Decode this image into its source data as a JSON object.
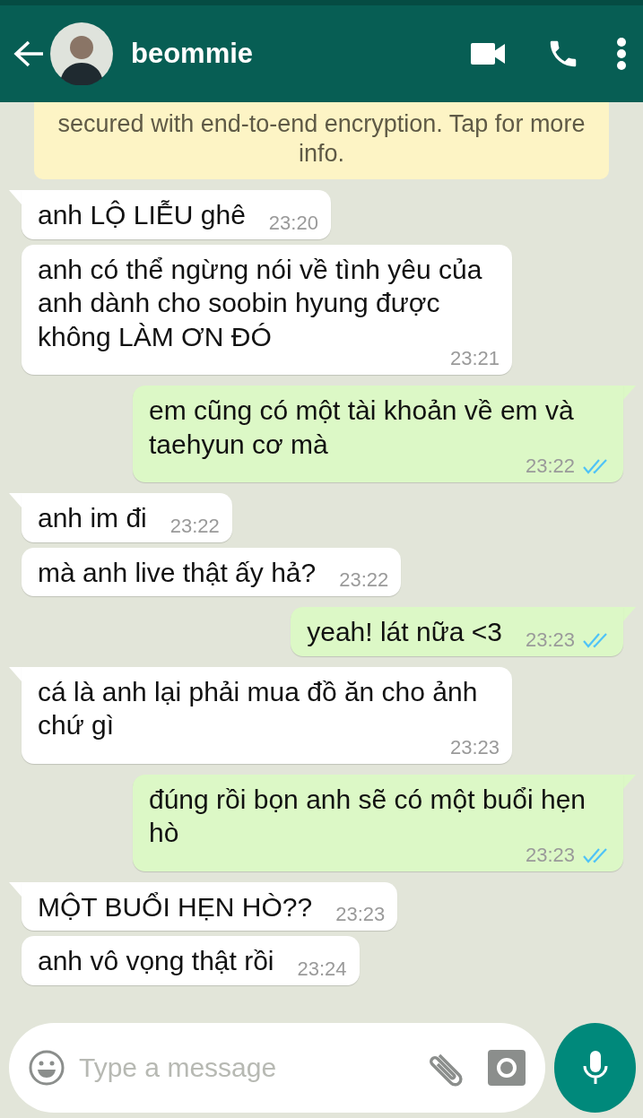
{
  "header": {
    "contact_name": "beommie"
  },
  "encryption_notice": "secured with end-to-end encryption. Tap for more info.",
  "messages": [
    {
      "kind": "in",
      "text": "anh LỘ LIỄU ghê",
      "time": "23:20"
    },
    {
      "kind": "in",
      "text": "anh có thể ngừng nói về tình yêu của anh dành cho soobin hyung được không LÀM ƠN ĐÓ",
      "time": "23:21"
    },
    {
      "kind": "out",
      "text": "em cũng có một tài khoản về em và taehyun cơ mà",
      "time": "23:22",
      "read": true
    },
    {
      "kind": "in",
      "text": "anh im đi",
      "time": "23:22"
    },
    {
      "kind": "in",
      "text": "mà anh live thật ấy hả?",
      "time": "23:22"
    },
    {
      "kind": "out",
      "text": "yeah! lát nữa <3",
      "time": "23:23",
      "read": true
    },
    {
      "kind": "in",
      "text": "cá là anh lại phải mua đồ ăn cho ảnh chứ gì",
      "time": "23:23"
    },
    {
      "kind": "out",
      "text": "đúng rồi bọn anh sẽ có một buổi hẹn hò",
      "time": "23:23",
      "read": true
    },
    {
      "kind": "in",
      "text": "MỘT BUỔI HẸN HÒ??",
      "time": "23:23"
    },
    {
      "kind": "in",
      "text": "anh vô vọng thật rồi",
      "time": "23:24"
    }
  ],
  "composer": {
    "placeholder": "Type a message"
  }
}
